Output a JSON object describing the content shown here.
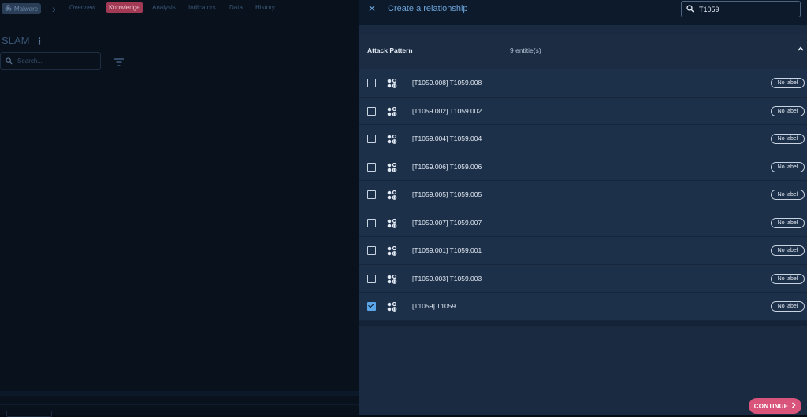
{
  "colors": {
    "accent": "#6aa3d8",
    "knowledge_tab": "#a33a55",
    "continue_button": "#d9547a",
    "checkbox_checked": "#5aa6e8"
  },
  "background_page": {
    "entity_chip": {
      "label": "Malware",
      "icon": "biohazard-icon"
    },
    "nav": [
      "Overview",
      "Knowledge",
      "Analysis",
      "Indicators",
      "Data",
      "History"
    ],
    "active_tab": "Knowledge",
    "title": "SLAM",
    "search": {
      "placeholder": "Search...",
      "value": ""
    }
  },
  "drawer": {
    "title": "Create a relationship",
    "search": {
      "value": "T1059",
      "placeholder": ""
    },
    "group": {
      "label": "Attack Pattern",
      "count_text": "9 entitie(s)"
    },
    "rows": [
      {
        "name": "[T1059.008] T1059.008",
        "label": "No label",
        "checked": false
      },
      {
        "name": "[T1059.002] T1059.002",
        "label": "No label",
        "checked": false
      },
      {
        "name": "[T1059.004] T1059.004",
        "label": "No label",
        "checked": false
      },
      {
        "name": "[T1059.006] T1059.006",
        "label": "No label",
        "checked": false
      },
      {
        "name": "[T1059.005] T1059.005",
        "label": "No label",
        "checked": false
      },
      {
        "name": "[T1059.007] T1059.007",
        "label": "No label",
        "checked": false
      },
      {
        "name": "[T1059.001] T1059.001",
        "label": "No label",
        "checked": false
      },
      {
        "name": "[T1059.003] T1059.003",
        "label": "No label",
        "checked": false
      },
      {
        "name": "[T1059] T1059",
        "label": "No label",
        "checked": true
      }
    ],
    "continue_label": "CONTINUE"
  }
}
